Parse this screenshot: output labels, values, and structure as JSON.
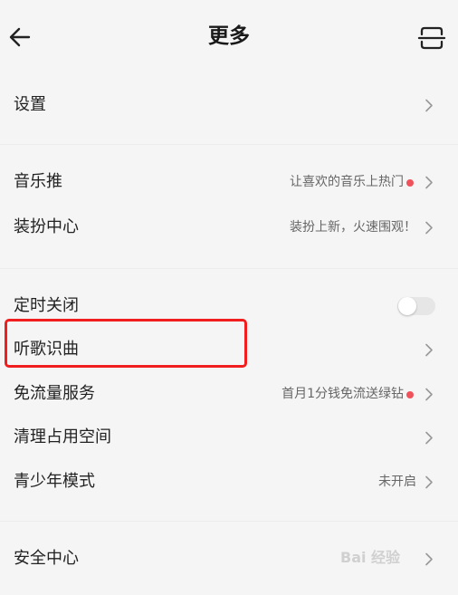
{
  "header": {
    "title": "更多"
  },
  "sections": [
    {
      "items": [
        {
          "label": "设置",
          "sub": "",
          "dot": false,
          "control": "chevron"
        }
      ]
    },
    {
      "items": [
        {
          "label": "音乐推",
          "sub": "让喜欢的音乐上热门",
          "dot": true,
          "control": "chevron"
        },
        {
          "label": "装扮中心",
          "sub": "装扮上新，火速围观！",
          "dot": false,
          "control": "chevron"
        }
      ]
    },
    {
      "items": [
        {
          "label": "定时关闭",
          "sub": "",
          "dot": false,
          "control": "toggle",
          "toggle_on": false
        },
        {
          "label": "听歌识曲",
          "sub": "",
          "dot": false,
          "control": "chevron",
          "highlighted": true
        },
        {
          "label": "免流量服务",
          "sub": "首月1分钱免流送绿钻",
          "dot": true,
          "control": "chevron"
        },
        {
          "label": "清理占用空间",
          "sub": "",
          "dot": false,
          "control": "chevron"
        },
        {
          "label": "青少年模式",
          "sub": "未开启",
          "dot": false,
          "control": "chevron"
        }
      ]
    },
    {
      "items": [
        {
          "label": "安全中心",
          "sub": "",
          "dot": false,
          "control": "chevron"
        }
      ]
    }
  ],
  "watermark": "Bai 经验",
  "colors": {
    "dot": "#f0525c",
    "highlight": "#f01e1e",
    "background": "#f5f5f5"
  }
}
